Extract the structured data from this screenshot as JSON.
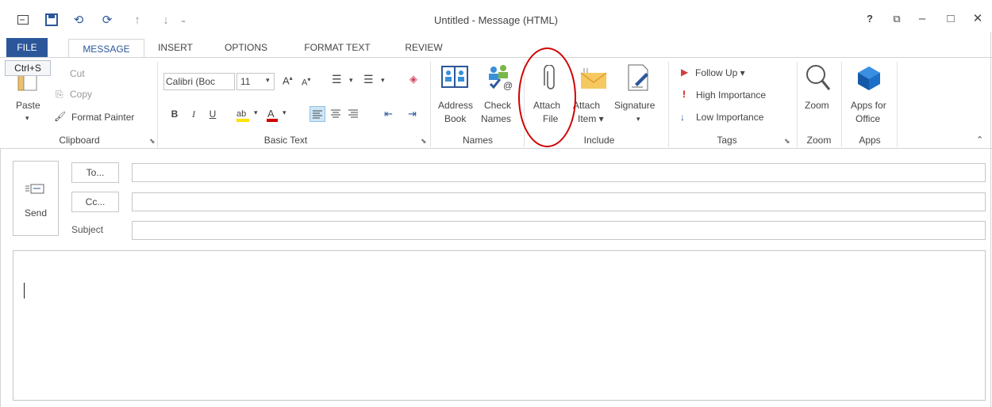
{
  "title": "Untitled - Message (HTML)",
  "window_controls": {
    "help": "?",
    "ribbon_options": "⧉",
    "minimize": "–",
    "maximize": "□",
    "close": "✕"
  },
  "tabs": [
    "FILE",
    "MESSAGE",
    "INSERT",
    "OPTIONS",
    "FORMAT TEXT",
    "REVIEW"
  ],
  "tooltip": "Ctrl+S",
  "clipboard": {
    "paste": "Paste",
    "cut": "Cut",
    "copy": "Copy",
    "format_painter": "Format Painter",
    "group": "Clipboard"
  },
  "basic_text": {
    "font": "Calibri (Boc",
    "size": "11",
    "bold": "B",
    "italic": "I",
    "underline": "U",
    "group": "Basic Text"
  },
  "names": {
    "address_book_1": "Address",
    "address_book_2": "Book",
    "check_names_1": "Check",
    "check_names_2": "Names",
    "group": "Names"
  },
  "include": {
    "attach_file_1": "Attach",
    "attach_file_2": "File",
    "attach_item_1": "Attach",
    "attach_item_2": "Item ▾",
    "signature": "Signature",
    "group": "Include"
  },
  "tags": {
    "follow_up": "Follow Up ▾",
    "high": "High Importance",
    "low": "Low Importance",
    "group": "Tags"
  },
  "zoom": {
    "button": "Zoom",
    "group": "Zoom"
  },
  "apps": {
    "button_1": "Apps for",
    "button_2": "Office",
    "group": "Apps"
  },
  "compose": {
    "send": "Send",
    "to": "To...",
    "cc": "Cc...",
    "subject": "Subject"
  },
  "colors": {
    "accent": "#2b579a",
    "annotation": "#d00000"
  },
  "icons": [
    "mail-icon",
    "save-icon",
    "undo-icon",
    "redo-icon",
    "up-arrow-icon",
    "down-arrow-icon",
    "customize-icon",
    "paperclip-icon",
    "envelope-icon",
    "signature-icon",
    "flag-icon",
    "magnifier-icon",
    "office-store-icon",
    "send-envelope-icon"
  ]
}
